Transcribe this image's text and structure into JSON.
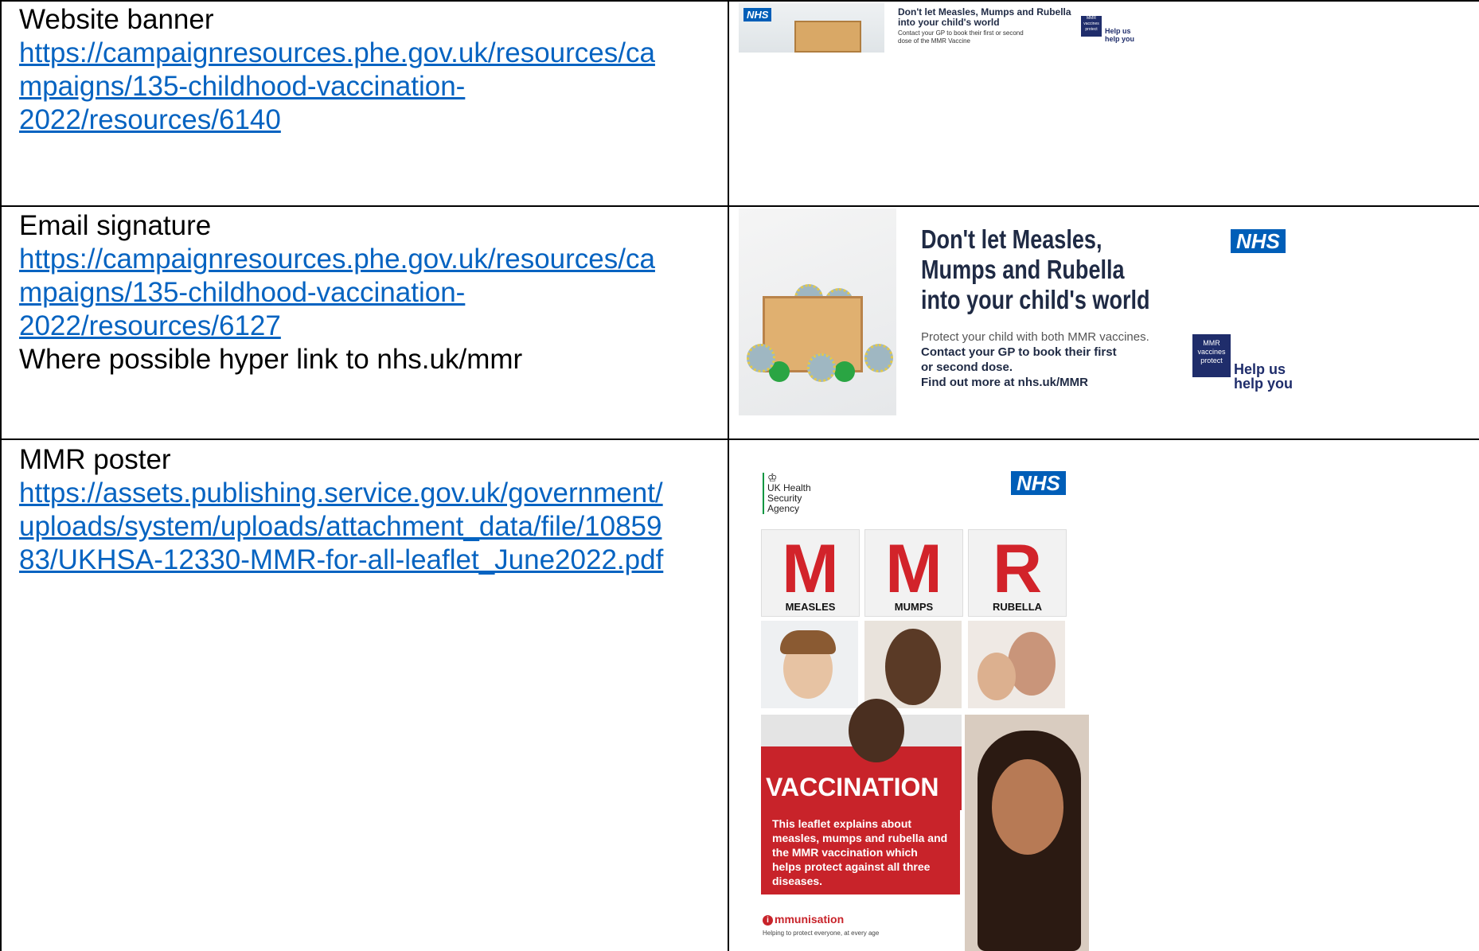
{
  "rows": [
    {
      "title": "Website banner",
      "link_lines": [
        "https://campaignresources.phe.gov.uk/resources/ca",
        "mpaigns/135-childhood-vaccination-",
        "2022/resources/6140"
      ]
    },
    {
      "title": "Email signature",
      "link_lines": [
        "https://campaignresources.phe.gov.uk/resources/ca",
        "mpaigns/135-childhood-vaccination-",
        "2022/resources/6127"
      ],
      "note": "Where possible hyper link to nhs.uk/mmr"
    },
    {
      "title": "MMR poster",
      "link_lines": [
        "https://assets.publishing.service.gov.uk/government/",
        "uploads/system/uploads/attachment_data/file/10859",
        "83/UKHSA-12330-MMR-for-all-leaflet_June2022.pdf"
      ]
    }
  ],
  "banner": {
    "nhs": "NHS",
    "headline_1": "Don't let Measles, Mumps and Rubella",
    "headline_2": "into your child's world",
    "sub_1": "Contact your GP to book their first or second",
    "sub_2": "dose of the MMR Vaccine",
    "badge": "MMR vaccines protect",
    "help_1": "Help us",
    "help_2": "help you"
  },
  "signature": {
    "headline_1": "Don't let Measles,",
    "headline_2": "Mumps and Rubella",
    "headline_3": "into your child's world",
    "line_1": "Protect your child with both MMR vaccines.",
    "line_2": "Contact your GP to book their first",
    "line_3": "or second dose.",
    "line_4": "Find out more at nhs.uk/MMR",
    "nhs": "NHS",
    "badge": "MMR vaccines protect",
    "help_1": "Help us",
    "help_2": "help you"
  },
  "poster": {
    "org_1": "UK Health",
    "org_2": "Security",
    "org_3": "Agency",
    "nhs": "NHS",
    "tiles": [
      {
        "letter": "M",
        "label": "MEASLES"
      },
      {
        "letter": "M",
        "label": "MUMPS"
      },
      {
        "letter": "R",
        "label": "RUBELLA"
      }
    ],
    "vaccination": "VACCINATION",
    "desc": "This leaflet explains about measles, mumps and rubella and the MMR vaccination which helps protect against all three diseases.",
    "immunisation": "mmunisation",
    "immunisation_i": "i",
    "tagline": "Helping to protect everyone, at every age"
  },
  "colors": {
    "link": "#0563c1",
    "nhs_blue": "#005eb8",
    "mmr_red": "#d2232a"
  }
}
